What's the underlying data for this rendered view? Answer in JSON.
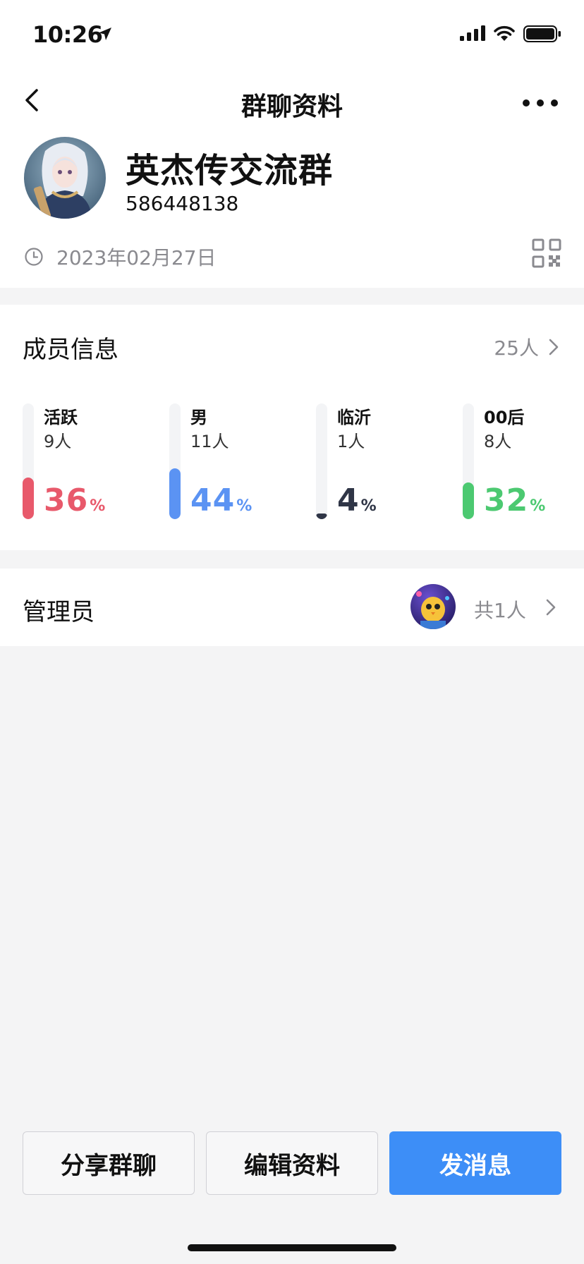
{
  "status_bar": {
    "time": "10:26"
  },
  "nav": {
    "title": "群聊资料"
  },
  "group": {
    "name": "英杰传交流群",
    "id": "586448138",
    "created_date": "2023年02月27日"
  },
  "members": {
    "title": "成员信息",
    "count": "25人",
    "stats": [
      {
        "label": "活跃",
        "count": "9人",
        "percent": 36,
        "color": "#e8596b"
      },
      {
        "label": "男",
        "count": "11人",
        "percent": 44,
        "color": "#5b93f3"
      },
      {
        "label": "临沂",
        "count": "1人",
        "percent": 4,
        "color": "#2f3546"
      },
      {
        "label": "00后",
        "count": "8人",
        "percent": 32,
        "color": "#4cc971"
      }
    ],
    "percent_unit": "%"
  },
  "admin": {
    "title": "管理员",
    "count": "共1人"
  },
  "actions": {
    "share": "分享群聊",
    "edit": "编辑资料",
    "message": "发消息"
  },
  "colors": {
    "primary": "#3d8ef7",
    "muted_text": "#8a8a8f"
  }
}
